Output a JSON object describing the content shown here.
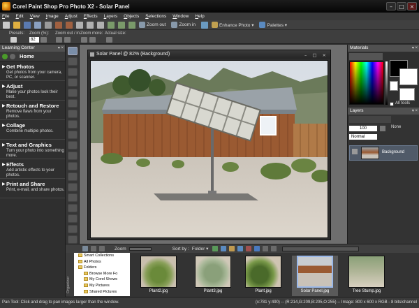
{
  "window": {
    "title": "Corel Paint Shop Pro Photo X2 - Solar Panel",
    "minimize": "–",
    "maximize": "□",
    "close": "×"
  },
  "menubar": [
    {
      "pre": "F",
      "rest": "ile"
    },
    {
      "pre": "E",
      "rest": "dit"
    },
    {
      "pre": "V",
      "rest": "iew"
    },
    {
      "pre": "I",
      "rest": "mage"
    },
    {
      "pre": "A",
      "rest": "djust"
    },
    {
      "pre": "E",
      "rest": "ffects"
    },
    {
      "pre": "L",
      "rest": "ayers"
    },
    {
      "pre": "O",
      "rest": "bjects"
    },
    {
      "pre": "S",
      "rest": "elections"
    },
    {
      "pre": "W",
      "rest": "indow"
    },
    {
      "pre": "H",
      "rest": "elp"
    }
  ],
  "toolbar": {
    "zoom_out": "Zoom out",
    "zoom_in": "Zoom in",
    "enhance_photo": "Enhance Photo ▾",
    "palettes": "Palettes ▾"
  },
  "tool_options": {
    "presets_label": "Presets:",
    "zoom_label": "Zoom (%):",
    "zoom_value": "82",
    "zoom_inout_label": "Zoom out / in:",
    "zoom_more_label": "Zoom more:",
    "actual_size_label": "Actual size:"
  },
  "learning_center": {
    "header": "Learning Center",
    "home": "Home",
    "items": [
      {
        "title": "Get Photos",
        "desc": "Get photos from your camera, PC, or scanner."
      },
      {
        "title": "Adjust",
        "desc": "Make your photos look their best."
      },
      {
        "title": "Retouch and Restore",
        "desc": "Remove flaws from your photos."
      },
      {
        "title": "Collage",
        "desc": "Combine multiple photos."
      },
      {
        "title": "Text and Graphics",
        "desc": "Turn your photo into something more."
      },
      {
        "title": "Effects",
        "desc": "Add artistic effects to your photos."
      },
      {
        "title": "Print and Share",
        "desc": "Print, e-mail, and share photos."
      }
    ]
  },
  "document": {
    "title": "Solar Panel @  82% (Background)"
  },
  "materials": {
    "header": "Materials",
    "all_tools_label": "All tools",
    "fg_color": "#000000",
    "bg_color": "#ffffff"
  },
  "layers": {
    "header": "Layers",
    "opacity": "100",
    "blend_mode": "Normal",
    "none_label": "None",
    "layer_name": "Background"
  },
  "organizer": {
    "side_label": "Organizer",
    "zoom_label": "Zoom",
    "sort_label": "Sort by :",
    "sort_value": "Folder ▾",
    "tree": [
      "Smart Collections",
      "All Photos",
      "Folders",
      "Browse More Fo",
      "My Corel Shows",
      "My Pictures",
      "Shared Pictures"
    ],
    "thumbnails": [
      {
        "caption": "Plant2.jpg"
      },
      {
        "caption": "Plant3.jpg"
      },
      {
        "caption": "Plant.jpg"
      },
      {
        "caption": "Solar Panel.jpg",
        "selected": true
      },
      {
        "caption": "Tree Stump.jpg"
      }
    ]
  },
  "status": {
    "left": "Pan Tool: Click and drag to pan images larger than the window.",
    "right": "(x:781 y:490) -- (R:214,G:209,B:205,O:255) -- Image: 800 x 600 x RGB - 8 bits/channel"
  }
}
